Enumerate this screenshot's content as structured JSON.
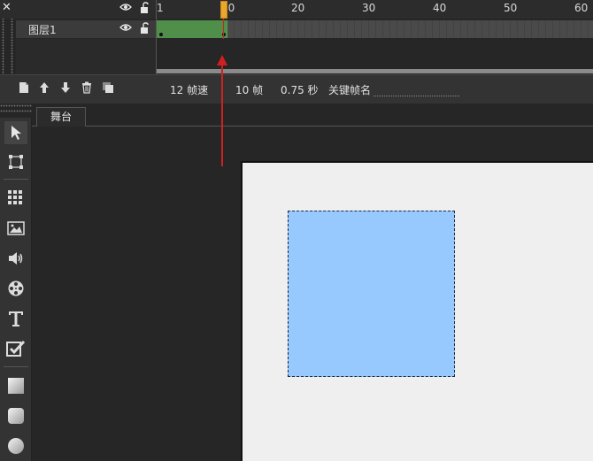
{
  "timeline": {
    "close_label": "✕",
    "ruler_labels": [
      "1",
      "10",
      "20",
      "30",
      "40",
      "50",
      "60"
    ],
    "layer_name": "图层1"
  },
  "toolbar": {
    "fps": "12 帧速",
    "frames": "10 帧",
    "seconds": "0.75 秒",
    "keyframe_name_label": "关键帧名"
  },
  "stage": {
    "tab_label": "舞台"
  },
  "colors": {
    "accent_playhead": "#e9a72c",
    "frames_fill": "#4f8f4a",
    "rect_fill": "#97c8fe",
    "annotation_arrow": "#d12020"
  },
  "tools": [
    "select-icon",
    "transform-icon",
    "grid-icon",
    "image-icon",
    "sound-icon",
    "film-reel-icon",
    "text-icon",
    "checkbox-icon",
    "rect-shape-icon",
    "rounded-rect-icon",
    "circle-icon"
  ]
}
